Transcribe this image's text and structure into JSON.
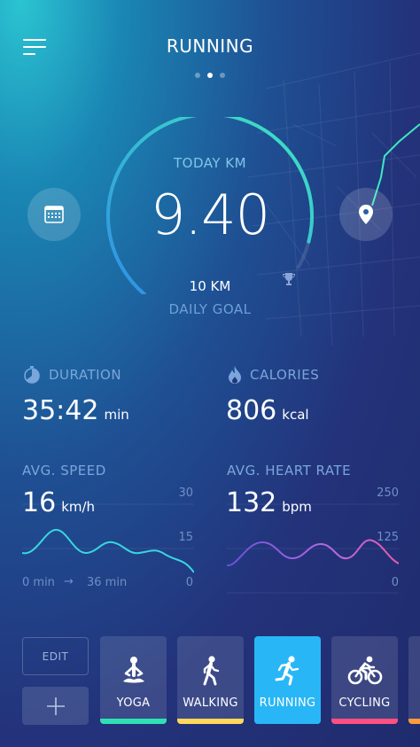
{
  "header": {
    "title": "RUNNING",
    "page_count": 3,
    "active_page": 1
  },
  "gauge": {
    "label": "TODAY KM",
    "value": "9.40",
    "goal_value": "10 KM",
    "goal_label": "DAILY GOAL",
    "progress": 0.94
  },
  "stats": {
    "duration": {
      "label": "DURATION",
      "value": "35:42",
      "unit": "min"
    },
    "calories": {
      "label": "CALORIES",
      "value": "806",
      "unit": "kcal"
    },
    "speed": {
      "label": "AVG. SPEED",
      "value": "16",
      "unit": "km/h",
      "ticks": [
        "30",
        "15",
        "0"
      ],
      "time_start": "0 min",
      "arrow": "→",
      "time_end": "36 min"
    },
    "heart_rate": {
      "label": "AVG. HEART RATE",
      "value": "132",
      "unit": "bpm",
      "ticks": [
        "250",
        "125",
        "0"
      ]
    }
  },
  "bottom": {
    "edit_label": "EDIT",
    "activities": [
      {
        "label": "YOGA",
        "icon": "yoga-icon",
        "bar_color": "#2fe0b4",
        "active": false
      },
      {
        "label": "WALKING",
        "icon": "walking-icon",
        "bar_color": "#ffd85a",
        "active": false
      },
      {
        "label": "RUNNING",
        "icon": "running-icon",
        "bar_color": "#29b6f6",
        "active": true
      },
      {
        "label": "CYCLING",
        "icon": "cycling-icon",
        "bar_color": "#ff4f83",
        "active": false
      }
    ]
  },
  "colors": {
    "accent": "#29b6f6",
    "gauge_start": "#2f9dea",
    "gauge_end": "#3ee8c0",
    "heart_line": "#a065e0",
    "speed_line": "#38d6e0"
  }
}
